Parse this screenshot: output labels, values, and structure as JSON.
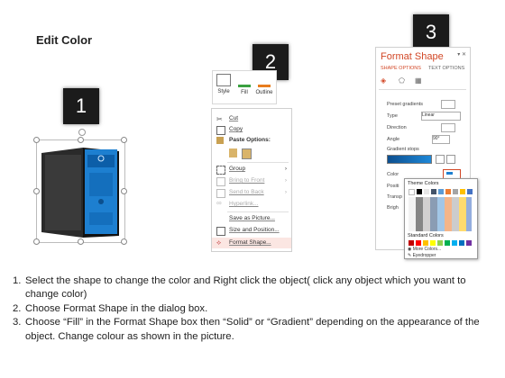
{
  "title": "Edit Color",
  "badges": {
    "one": "1",
    "two": "2",
    "three": "3"
  },
  "ribbon": {
    "style_label": "Style",
    "fill_label": "Fill",
    "outline_label": "Outline"
  },
  "context_menu": {
    "items": [
      {
        "label": "Cut",
        "disabled": false,
        "icon": "scissors-icon"
      },
      {
        "label": "Copy",
        "disabled": false,
        "icon": "copy-icon"
      },
      {
        "label": "Paste Options:",
        "disabled": false,
        "icon": "paste-icon"
      },
      {
        "label": "Group",
        "disabled": false,
        "icon": "group-icon",
        "submenu": true
      },
      {
        "label": "Bring to Front",
        "disabled": true,
        "icon": "bring-front-icon",
        "submenu": true
      },
      {
        "label": "Send to Back",
        "disabled": true,
        "icon": "send-back-icon",
        "submenu": true
      },
      {
        "label": "Hyperlink...",
        "disabled": true,
        "icon": "hyperlink-icon"
      },
      {
        "label": "Save as Picture...",
        "disabled": false,
        "icon": ""
      },
      {
        "label": "Size and Position...",
        "disabled": false,
        "icon": "size-icon"
      },
      {
        "label": "Format Shape...",
        "disabled": false,
        "icon": "format-shape-icon",
        "highlighted": true
      }
    ]
  },
  "format_pane": {
    "title": "Format Shape",
    "tab_shape": "SHAPE OPTIONS",
    "tab_text": "TEXT OPTIONS",
    "preset_label": "Preset gradients",
    "type_label": "Type",
    "type_value": "Linear",
    "direction_label": "Direction",
    "angle_label": "Angle",
    "angle_value": "90°",
    "stops_label": "Gradient stops",
    "color_label": "Color",
    "position_label": "Positi",
    "transparency_label": "Transp",
    "brightness_label": "Brigh"
  },
  "palette": {
    "theme_label": "Theme Colors",
    "standard_label": "Standard Colors",
    "more_colors": "More Colors...",
    "eyedropper": "Eyedropper",
    "theme_top": [
      "#ffffff",
      "#000000",
      "#e7e6e6",
      "#44546a",
      "#5b9bd5",
      "#ed7d31",
      "#a5a5a5",
      "#ffc000",
      "#4472c4",
      "#70ad47"
    ],
    "standard": [
      "#c00000",
      "#ff0000",
      "#ffc000",
      "#ffff00",
      "#92d050",
      "#00b050",
      "#00b0f0",
      "#0070c0",
      "#002060",
      "#7030a0"
    ]
  },
  "steps": [
    {
      "num": "1.",
      "text": "Select the shape to change the color and Right click the object( click any object which you want to change color)"
    },
    {
      "num": "2.",
      "text": "Choose Format Shape in the dialog box."
    },
    {
      "num": "3.",
      "text": "Choose “Fill” in the Format Shape box then “Solid” or “Gradient” depending on the appearance of the object. Change colour as shown in the picture."
    }
  ]
}
